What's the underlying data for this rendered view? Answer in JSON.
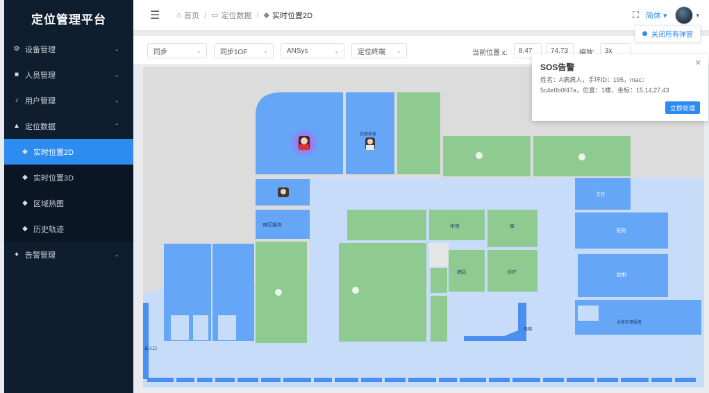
{
  "app": {
    "title": "定位管理平台"
  },
  "sidebar": {
    "items": [
      {
        "label": "设备管理",
        "icon": "gear-icon"
      },
      {
        "label": "人员管理",
        "icon": "people-icon"
      },
      {
        "label": "用户管理",
        "icon": "user-icon"
      },
      {
        "label": "定位数据",
        "icon": "location-icon"
      },
      {
        "label": "告警管理",
        "icon": "bell-icon"
      }
    ],
    "sub_items": [
      {
        "label": "实时位置2D",
        "icon": "pin-icon"
      },
      {
        "label": "实时位置3D",
        "icon": "pin-icon"
      },
      {
        "label": "区域热图",
        "icon": "pin-icon"
      },
      {
        "label": "历史轨迹",
        "icon": "pin-icon"
      }
    ]
  },
  "header": {
    "breadcrumb": [
      "首页",
      "定位数据",
      "实时位置2D"
    ],
    "lang_label": "简体",
    "close_sos_label": "关闭所有弹窗"
  },
  "toolbar": {
    "select1": "同步",
    "select2": "同步1OF",
    "select3": "ANSys",
    "select4": "定位终端",
    "pos_label": "当前位置 x:",
    "x_value": "8.47",
    "y_value": "74.73",
    "zoom_label": "缩放:",
    "zoom_value": "3x"
  },
  "sos": {
    "title": "SOS告警",
    "line1": "姓名：A病病人，手环ID：195，mac：",
    "line2": "5c4e0b0f47a，位置：1楼，坐标：15,14,27.43",
    "button": "立即处理"
  },
  "map": {
    "labels": {
      "person2": "走廊病者",
      "room_mid": "病区服务",
      "r1": "中央",
      "r2": "库",
      "r3": "病区",
      "r4": "诊疗",
      "r5": "主任",
      "r6": "配电",
      "r7": "控制",
      "r8": "电梯",
      "r9": "业务办理服务",
      "r10": "出入口"
    }
  },
  "colors": {
    "blue_room": "#66a6f7",
    "green_room": "#8fcb91",
    "corridor": "#c6dcf9",
    "accent": "#2d8cf0",
    "sidebar": "#0f1e2e"
  }
}
